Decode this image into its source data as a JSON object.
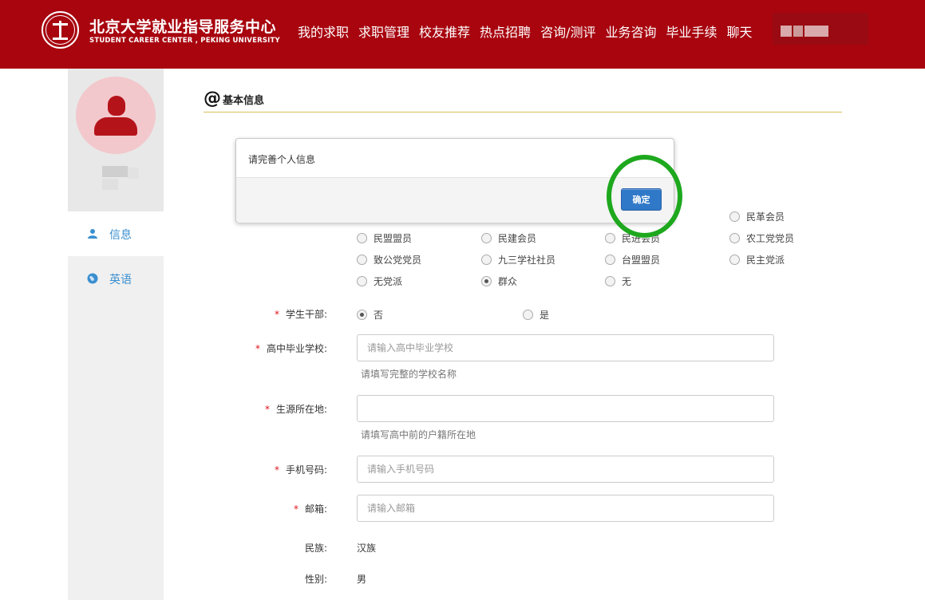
{
  "header": {
    "brand_cn": "北京大学就业指导服务中心",
    "brand_en": "STUDENT CAREER CENTER , PEKING UNIVERSITY",
    "nav": [
      "我的求职",
      "求职管理",
      "校友推荐",
      "热点招聘",
      "咨询/测评",
      "业务咨询",
      "毕业手续",
      "聊天"
    ]
  },
  "sidebar": {
    "items": [
      {
        "label": "信息",
        "icon": "user-icon"
      },
      {
        "label": "英语",
        "icon": "globe-icon"
      }
    ]
  },
  "section": {
    "title": "基本信息"
  },
  "party": {
    "partial_top_right": "民革会员",
    "row2": [
      "民盟盟员",
      "民建会员",
      "民进会员",
      "农工党党员"
    ],
    "row3": [
      "致公党党员",
      "九三学社社员",
      "台盟盟员",
      "民主党派"
    ],
    "row4": [
      "无党派",
      "群众",
      "无"
    ],
    "selected": "群众"
  },
  "form": {
    "cadre": {
      "label": "学生干部:",
      "options": [
        "否",
        "是"
      ],
      "selected": "否"
    },
    "high_school": {
      "label": "高中毕业学校:",
      "placeholder": "请输入高中毕业学校",
      "hint": "请填写完整的学校名称",
      "value": ""
    },
    "origin": {
      "label": "生源所在地:",
      "placeholder": "",
      "hint": "请填写高中前的户籍所在地",
      "value": ""
    },
    "phone": {
      "label": "手机号码:",
      "placeholder": "请输入手机号码",
      "value": ""
    },
    "email": {
      "label": "邮箱:",
      "placeholder": "请输入邮箱",
      "value": ""
    },
    "ethnicity": {
      "label": "民族:",
      "value": "汉族"
    },
    "gender": {
      "label": "性别:",
      "value": "男"
    }
  },
  "modal": {
    "message": "请完善个人信息",
    "ok_label": "确定"
  },
  "colors": {
    "header_bg": "#a8050f",
    "link_blue": "#3a8fd0",
    "ok_button": "#3079c8",
    "highlight_circle": "#1ea81e",
    "required_star": "#e0141d"
  }
}
